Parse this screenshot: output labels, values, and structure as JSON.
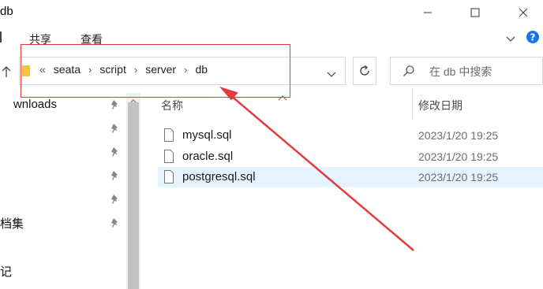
{
  "window": {
    "title": "db",
    "minimize_icon": "minimize-icon",
    "maximize_icon": "maximize-icon",
    "close_icon": "close-icon"
  },
  "ribbon": {
    "tabs": [
      "共享",
      "查看"
    ],
    "expand_icon": "chevron-down-icon",
    "help_icon": "help-icon"
  },
  "address": {
    "overflow": "«",
    "crumbs": [
      "seata",
      "script",
      "server",
      "db"
    ],
    "dropdown_icon": "chevron-down-icon",
    "refresh_icon": "refresh-icon"
  },
  "search": {
    "placeholder": "在 db 中搜索"
  },
  "nav": {
    "items": [
      "wnloads",
      "档集",
      "记"
    ],
    "pin_icon": "pin-icon",
    "collapse_icon": "chevron-up-icon"
  },
  "file_list": {
    "columns": [
      "名称",
      "修改日期"
    ],
    "rows": [
      {
        "name": "mysql.sql",
        "date": "2023/1/20 19:25",
        "selected": false
      },
      {
        "name": "oracle.sql",
        "date": "2023/1/20 19:25",
        "selected": false
      },
      {
        "name": "postgresql.sql",
        "date": "2023/1/20 19:25",
        "selected": true
      }
    ]
  },
  "colors": {
    "annotation": "#e63b3b",
    "selection": "#e5f3ff",
    "help": "#1a73e8"
  }
}
